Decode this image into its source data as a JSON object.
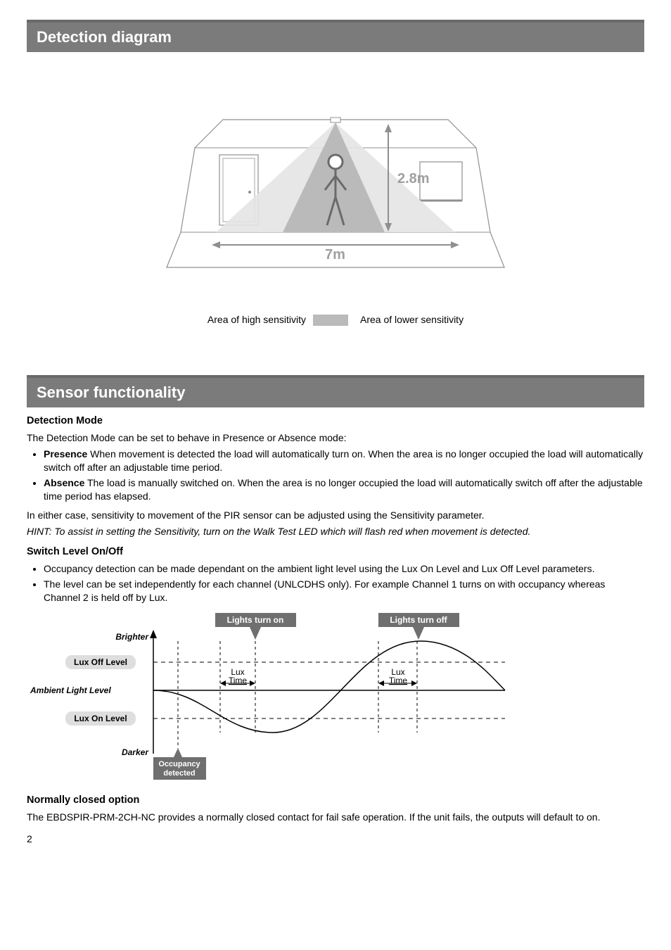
{
  "section1_title": "Detection diagram",
  "diagram": {
    "height_label": "2.8m",
    "width_label": "7m"
  },
  "legend": {
    "high": "Area of high sensitivity",
    "low": "Area of lower sensitivity"
  },
  "section2_title": "Sensor functionality",
  "detection_mode": {
    "heading": "Detection Mode",
    "intro": "The Detection Mode can be set to behave in Presence or Absence mode:",
    "presence_label": "Presence",
    "presence_text": " When movement is detected the load will automatically turn on. When the area is no longer occupied the load will automatically switch off after an adjustable time period.",
    "absence_label": "Absence",
    "absence_text": " The load is manually switched on. When the area is no longer occupied the load will automatically switch off after the adjustable time period has elapsed.",
    "either_case": "In either case, sensitivity to movement of the PIR sensor  can be adjusted using the Sensitivity parameter.",
    "hint": "HINT: To assist in setting the Sensitivity, turn on the Walk Test LED which will flash red when movement is detected."
  },
  "switch_level": {
    "heading": "Switch Level On/Off",
    "b1": "Occupancy detection can be made dependant on the ambient light level using the Lux On Level and Lux Off Level parameters.",
    "b2": "The level can be set independently for each channel (UNLCDHS only). For example Channel 1 turns on with occupancy whereas Channel 2 is held off by Lux."
  },
  "chart": {
    "lights_on": "Lights turn on",
    "lights_off": "Lights turn off",
    "brighter": "Brighter",
    "darker": "Darker",
    "lux_off": "Lux Off Level",
    "lux_on": "Lux On Level",
    "ambient": "Ambient Light Level",
    "lux_time1": "Lux\nTime",
    "lux_time2": "Lux\nTime",
    "occupancy": "Occupancy\ndetected"
  },
  "normally_closed": {
    "heading": "Normally closed option",
    "text": "The EBDSPIR-PRM-2CH-NC provides a normally closed contact for fail safe operation. If the unit fails, the outputs will default to on."
  },
  "page_num": "2"
}
